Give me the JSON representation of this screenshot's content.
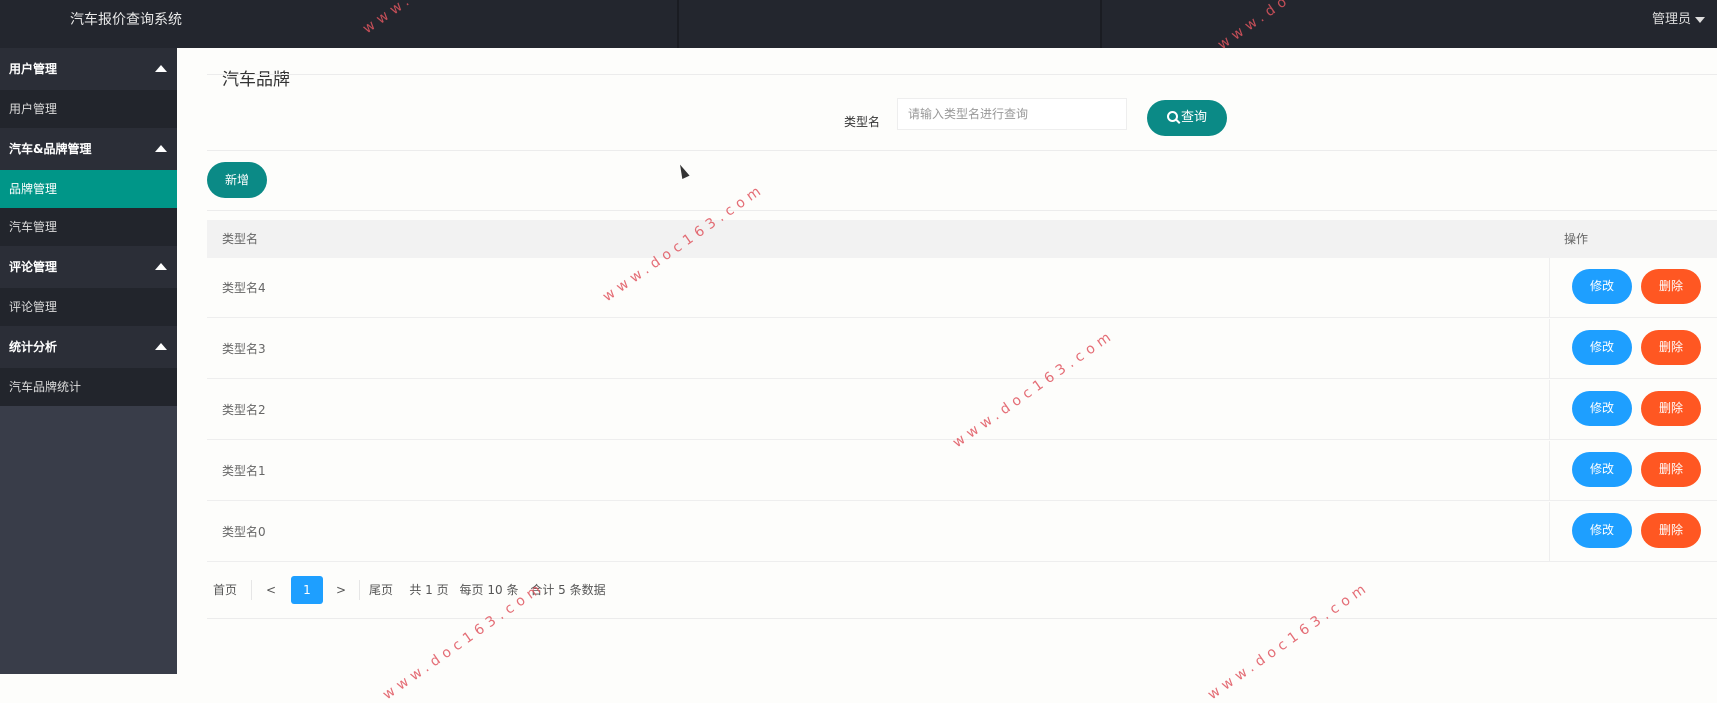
{
  "app": {
    "title": "汽车报价查询系统",
    "user_menu": "管理员"
  },
  "sidebar": {
    "groups": [
      {
        "label": "用户管理",
        "items": [
          {
            "label": "用户管理",
            "active": false
          }
        ]
      },
      {
        "label": "汽车&品牌管理",
        "items": [
          {
            "label": "品牌管理",
            "active": true
          },
          {
            "label": "汽车管理",
            "active": false
          }
        ]
      },
      {
        "label": "评论管理",
        "items": [
          {
            "label": "评论管理",
            "active": false
          }
        ]
      },
      {
        "label": "统计分析",
        "items": [
          {
            "label": "汽车品牌统计",
            "active": false
          }
        ]
      }
    ]
  },
  "main": {
    "page_title": "汽车品牌",
    "search": {
      "label": "类型名",
      "placeholder": "请输入类型名进行查询",
      "button": "查询"
    },
    "add_button": "新增",
    "table": {
      "headers": {
        "name": "类型名",
        "ops": "操作"
      },
      "edit_label": "修改",
      "delete_label": "删除",
      "rows": [
        "类型名4",
        "类型名3",
        "类型名2",
        "类型名1",
        "类型名0"
      ]
    },
    "pager": {
      "first": "首页",
      "prev": "<",
      "current": "1",
      "next": ">",
      "last": "尾页",
      "total_pages": "共 1 页",
      "per_page": "每页 10 条",
      "total_records": "合计 5 条数据"
    }
  },
  "watermark": "www.doc163.com",
  "colors": {
    "accent": "#009688",
    "primary_button": "#0b8a86",
    "edit": "#1e9fff",
    "delete": "#ff5722",
    "topbar": "#23262e",
    "sidebar": "#393d49"
  }
}
